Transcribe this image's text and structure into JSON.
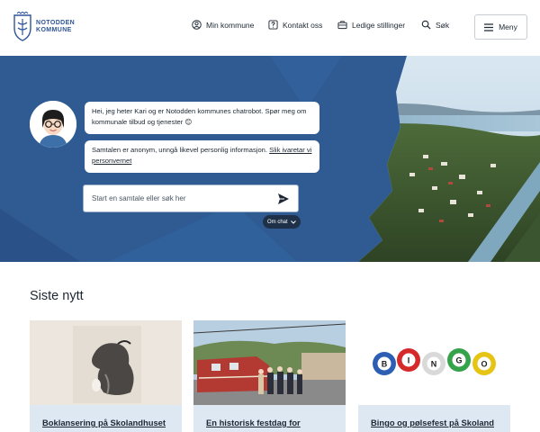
{
  "header": {
    "logo_line1": "NOTODDEN",
    "logo_line2": "KOMMUNE",
    "nav": {
      "min_kommune": "Min kommune",
      "kontakt_oss": "Kontakt oss",
      "ledige_stillinger": "Ledige stillinger",
      "sok": "Søk"
    },
    "menu_label": "Meny"
  },
  "hero": {
    "bubble1": "Hei, jeg heter Kari og er Notodden kommunes chatrobot. Spør meg om kommunale tilbud og tjenester 😊",
    "bubble2_text": "Samtalen er anonym, unngå likevel personlig informasjon. ",
    "bubble2_link": "Slik ivaretar vi personvernet",
    "input_placeholder": "Start en samtale eller søk her",
    "om_chat": "Om chat"
  },
  "news": {
    "title": "Siste nytt",
    "cards": [
      {
        "title": "Boklansering på Skolandhuset"
      },
      {
        "title": "En historisk festdag for"
      },
      {
        "title": "Bingo og pølsefest på Skoland"
      }
    ]
  },
  "bingo_letters": [
    "B",
    "I",
    "N",
    "G",
    "O"
  ],
  "colors": {
    "hero_blue": "#2f5b92",
    "caption_bg": "#dde8f3",
    "logo_blue": "#2f5597"
  }
}
